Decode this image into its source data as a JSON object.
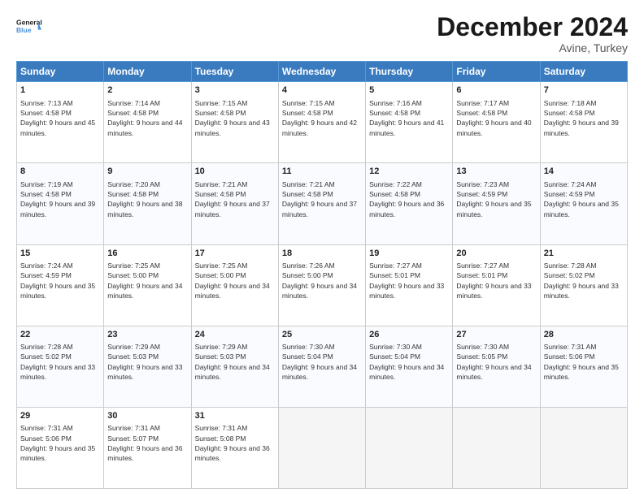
{
  "logo": {
    "name": "General",
    "name2": "Blue"
  },
  "title": "December 2024",
  "location": "Avine, Turkey",
  "days_header": [
    "Sunday",
    "Monday",
    "Tuesday",
    "Wednesday",
    "Thursday",
    "Friday",
    "Saturday"
  ],
  "weeks": [
    [
      {
        "day": "1",
        "sunrise": "7:13 AM",
        "sunset": "4:58 PM",
        "daylight": "9 hours and 45 minutes."
      },
      {
        "day": "2",
        "sunrise": "7:14 AM",
        "sunset": "4:58 PM",
        "daylight": "9 hours and 44 minutes."
      },
      {
        "day": "3",
        "sunrise": "7:15 AM",
        "sunset": "4:58 PM",
        "daylight": "9 hours and 43 minutes."
      },
      {
        "day": "4",
        "sunrise": "7:15 AM",
        "sunset": "4:58 PM",
        "daylight": "9 hours and 42 minutes."
      },
      {
        "day": "5",
        "sunrise": "7:16 AM",
        "sunset": "4:58 PM",
        "daylight": "9 hours and 41 minutes."
      },
      {
        "day": "6",
        "sunrise": "7:17 AM",
        "sunset": "4:58 PM",
        "daylight": "9 hours and 40 minutes."
      },
      {
        "day": "7",
        "sunrise": "7:18 AM",
        "sunset": "4:58 PM",
        "daylight": "9 hours and 39 minutes."
      }
    ],
    [
      {
        "day": "8",
        "sunrise": "7:19 AM",
        "sunset": "4:58 PM",
        "daylight": "9 hours and 39 minutes."
      },
      {
        "day": "9",
        "sunrise": "7:20 AM",
        "sunset": "4:58 PM",
        "daylight": "9 hours and 38 minutes."
      },
      {
        "day": "10",
        "sunrise": "7:21 AM",
        "sunset": "4:58 PM",
        "daylight": "9 hours and 37 minutes."
      },
      {
        "day": "11",
        "sunrise": "7:21 AM",
        "sunset": "4:58 PM",
        "daylight": "9 hours and 37 minutes."
      },
      {
        "day": "12",
        "sunrise": "7:22 AM",
        "sunset": "4:58 PM",
        "daylight": "9 hours and 36 minutes."
      },
      {
        "day": "13",
        "sunrise": "7:23 AM",
        "sunset": "4:59 PM",
        "daylight": "9 hours and 35 minutes."
      },
      {
        "day": "14",
        "sunrise": "7:24 AM",
        "sunset": "4:59 PM",
        "daylight": "9 hours and 35 minutes."
      }
    ],
    [
      {
        "day": "15",
        "sunrise": "7:24 AM",
        "sunset": "4:59 PM",
        "daylight": "9 hours and 35 minutes."
      },
      {
        "day": "16",
        "sunrise": "7:25 AM",
        "sunset": "5:00 PM",
        "daylight": "9 hours and 34 minutes."
      },
      {
        "day": "17",
        "sunrise": "7:25 AM",
        "sunset": "5:00 PM",
        "daylight": "9 hours and 34 minutes."
      },
      {
        "day": "18",
        "sunrise": "7:26 AM",
        "sunset": "5:00 PM",
        "daylight": "9 hours and 34 minutes."
      },
      {
        "day": "19",
        "sunrise": "7:27 AM",
        "sunset": "5:01 PM",
        "daylight": "9 hours and 33 minutes."
      },
      {
        "day": "20",
        "sunrise": "7:27 AM",
        "sunset": "5:01 PM",
        "daylight": "9 hours and 33 minutes."
      },
      {
        "day": "21",
        "sunrise": "7:28 AM",
        "sunset": "5:02 PM",
        "daylight": "9 hours and 33 minutes."
      }
    ],
    [
      {
        "day": "22",
        "sunrise": "7:28 AM",
        "sunset": "5:02 PM",
        "daylight": "9 hours and 33 minutes."
      },
      {
        "day": "23",
        "sunrise": "7:29 AM",
        "sunset": "5:03 PM",
        "daylight": "9 hours and 33 minutes."
      },
      {
        "day": "24",
        "sunrise": "7:29 AM",
        "sunset": "5:03 PM",
        "daylight": "9 hours and 34 minutes."
      },
      {
        "day": "25",
        "sunrise": "7:30 AM",
        "sunset": "5:04 PM",
        "daylight": "9 hours and 34 minutes."
      },
      {
        "day": "26",
        "sunrise": "7:30 AM",
        "sunset": "5:04 PM",
        "daylight": "9 hours and 34 minutes."
      },
      {
        "day": "27",
        "sunrise": "7:30 AM",
        "sunset": "5:05 PM",
        "daylight": "9 hours and 34 minutes."
      },
      {
        "day": "28",
        "sunrise": "7:31 AM",
        "sunset": "5:06 PM",
        "daylight": "9 hours and 35 minutes."
      }
    ],
    [
      {
        "day": "29",
        "sunrise": "7:31 AM",
        "sunset": "5:06 PM",
        "daylight": "9 hours and 35 minutes."
      },
      {
        "day": "30",
        "sunrise": "7:31 AM",
        "sunset": "5:07 PM",
        "daylight": "9 hours and 36 minutes."
      },
      {
        "day": "31",
        "sunrise": "7:31 AM",
        "sunset": "5:08 PM",
        "daylight": "9 hours and 36 minutes."
      },
      null,
      null,
      null,
      null
    ]
  ]
}
